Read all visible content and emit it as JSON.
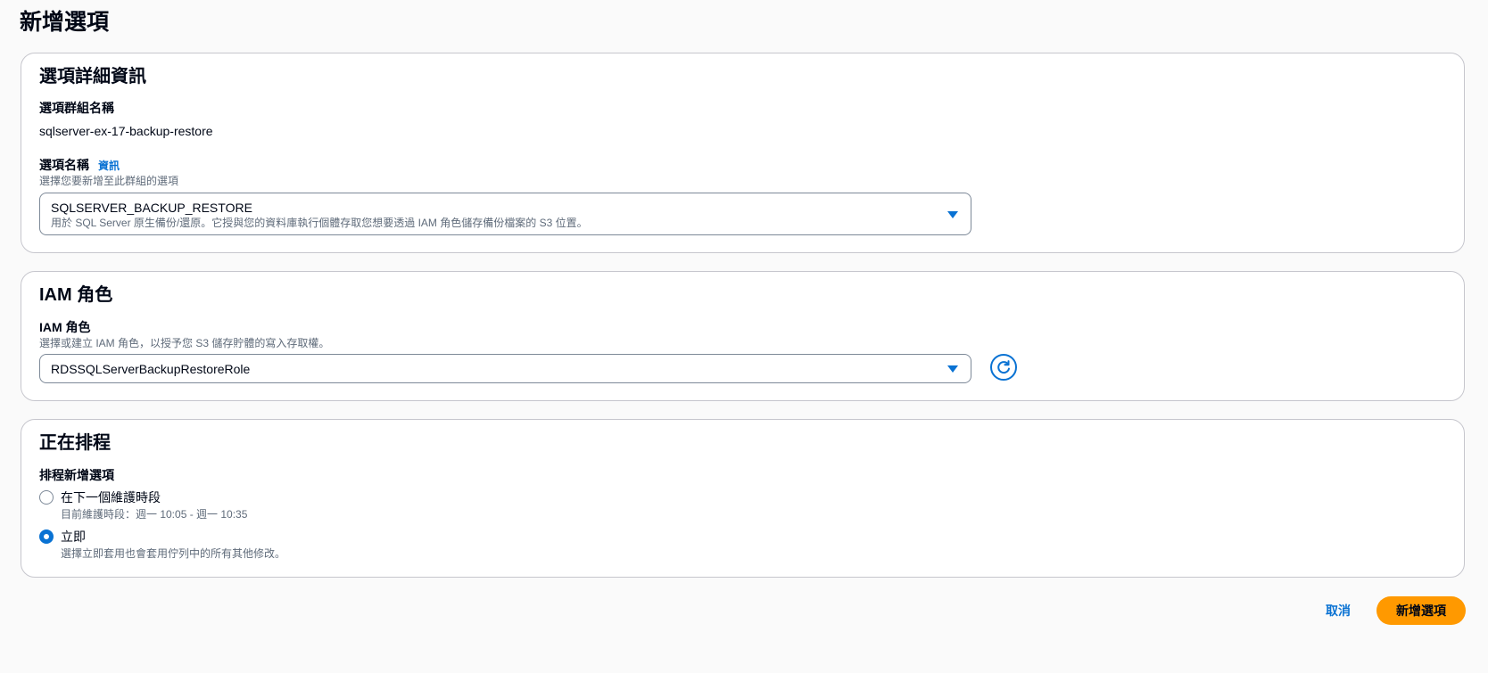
{
  "page": {
    "title": "新增選項"
  },
  "details": {
    "title": "選項詳細資訊",
    "group_label": "選項群組名稱",
    "group_value": "sqlserver-ex-17-backup-restore",
    "option_label": "選項名稱",
    "info_link": "資訊",
    "option_desc": "選擇您要新增至此群組的選項",
    "option_value": "SQLSERVER_BACKUP_RESTORE",
    "option_value_desc": "用於 SQL Server 原生備份/還原。它授與您的資料庫執行個體存取您想要透過 IAM 角色儲存備份檔案的 S3 位置。"
  },
  "iam": {
    "title": "IAM 角色",
    "label": "IAM 角色",
    "desc": "選擇或建立 IAM 角色，以授予您 S3 儲存貯體的寫入存取權。",
    "value": "RDSSQLServerBackupRestoreRole"
  },
  "schedule": {
    "title": "正在排程",
    "label": "排程新增選項",
    "options": [
      {
        "label": "在下一個維護時段",
        "desc": "目前維護時段：週一 10:05 - 週一 10:35",
        "selected": false
      },
      {
        "label": "立即",
        "desc": "選擇立即套用也會套用佇列中的所有其他修改。",
        "selected": true
      }
    ]
  },
  "footer": {
    "cancel": "取消",
    "submit": "新增選項"
  },
  "colors": {
    "accent": "#0972d3",
    "primary": "#ff9900",
    "border": "#c6c6cd"
  },
  "icons": {
    "dropdown": "caret-down-icon",
    "refresh": "refresh-icon"
  }
}
